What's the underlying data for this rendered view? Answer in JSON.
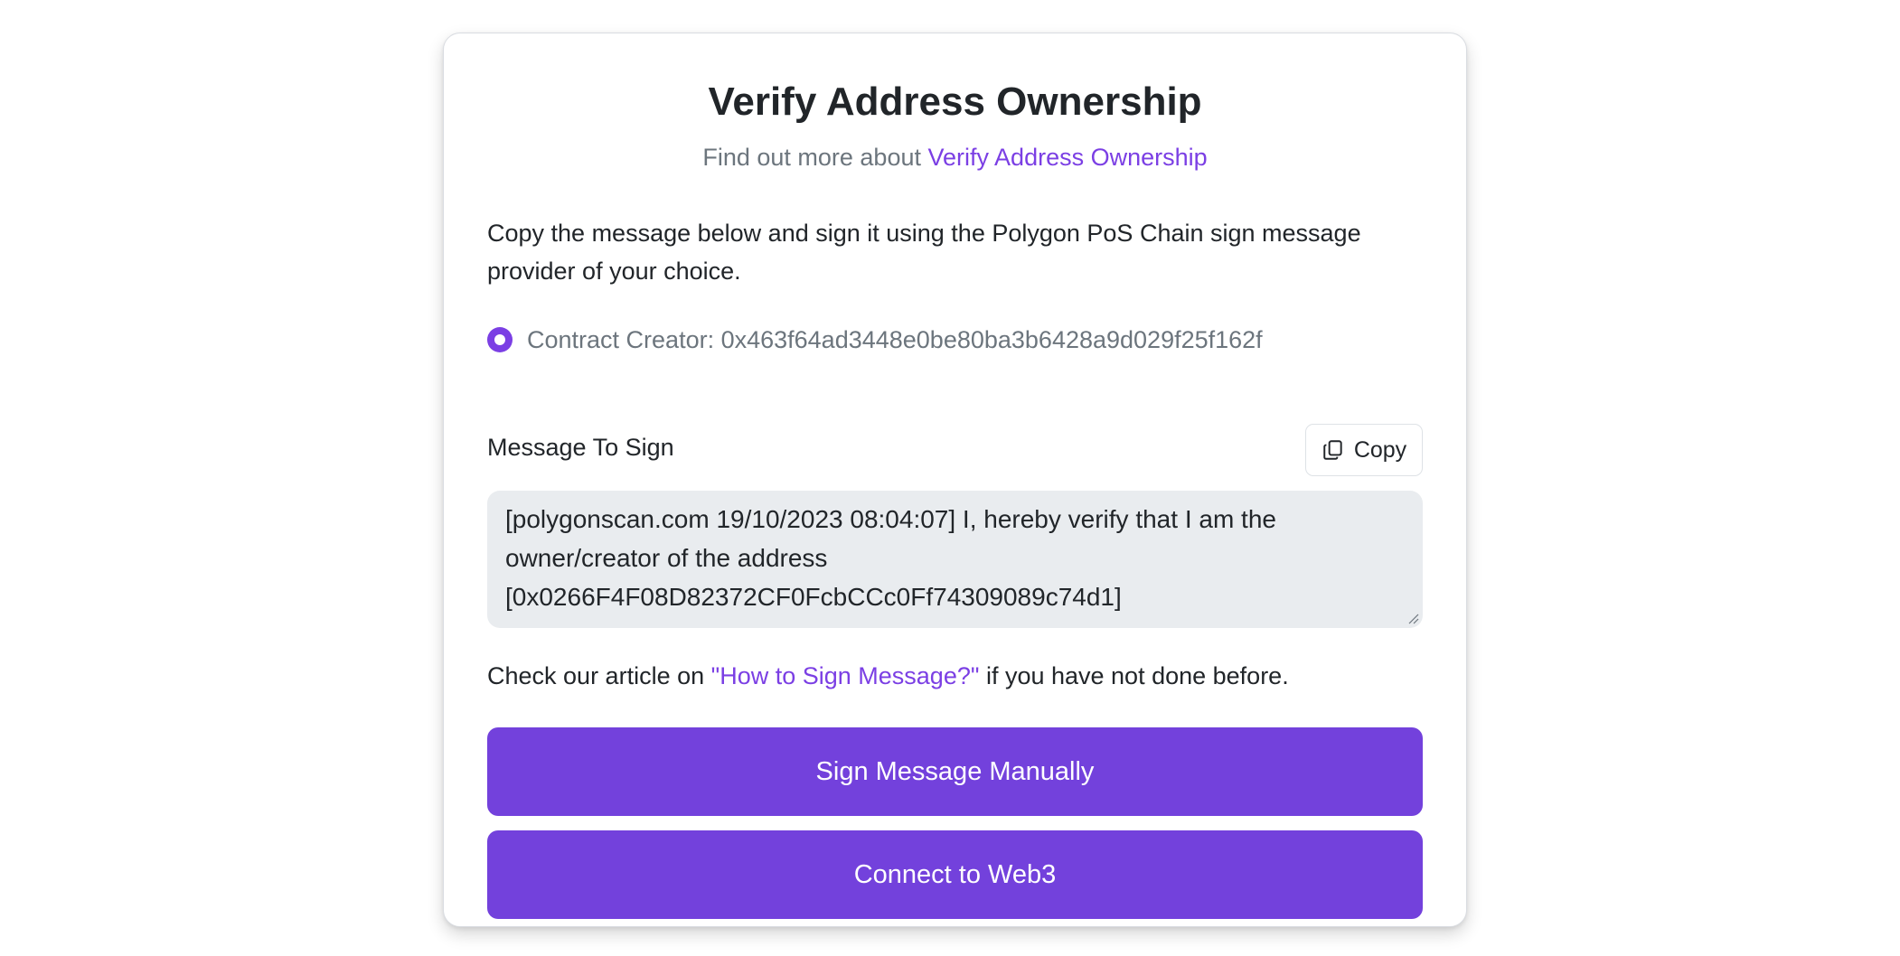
{
  "title": "Verify Address Ownership",
  "subtitle": {
    "prefix": "Find out more about ",
    "link": "Verify Address Ownership"
  },
  "instructions": "Copy the message below and sign it using the Polygon PoS Chain sign message provider of your choice.",
  "radio": {
    "label": "Contract Creator: 0x463f64ad3448e0be80ba3b6428a9d029f25f162f",
    "checked": true
  },
  "message": {
    "label": "Message To Sign",
    "copy_label": "Copy",
    "copy_icon": "copy-icon",
    "lines": [
      "[polygonscan.com 19/10/2023 08:04:07] I, hereby verify that I am the",
      "owner/creator of the address",
      "[0x0266F4F08D82372CF0FcbCCc0Ff74309089c74d1]"
    ]
  },
  "article": {
    "prefix": "Check our article on ",
    "link": "\"How to Sign Message?\"",
    "suffix": " if you have not done before."
  },
  "buttons": {
    "sign_manually": "Sign Message Manually",
    "connect_web3": "Connect to Web3"
  },
  "colors": {
    "accent": "#7341dc",
    "link": "#7b3fe4",
    "textarea_bg": "#e9ecef"
  }
}
